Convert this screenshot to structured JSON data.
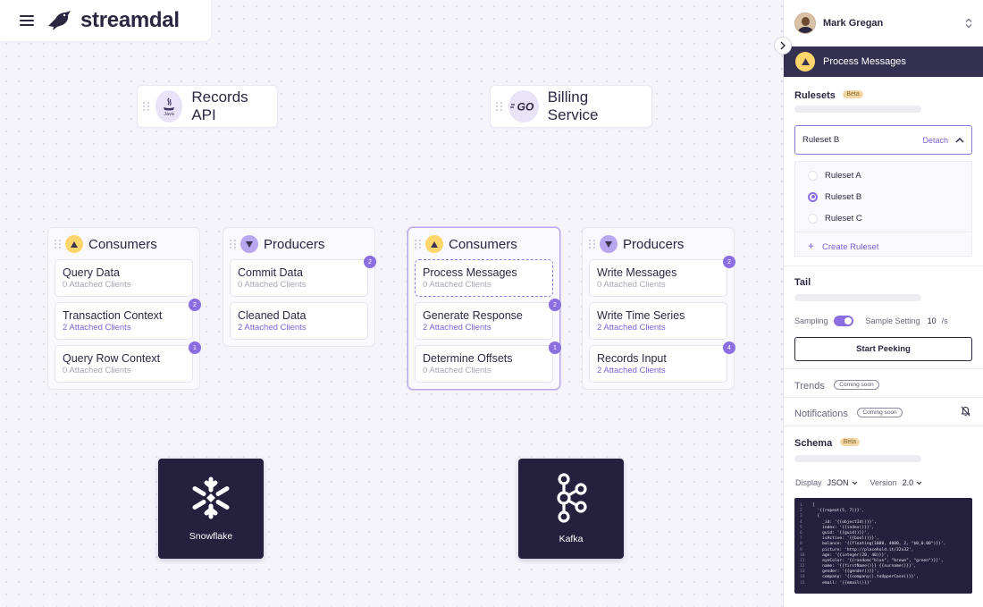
{
  "brand": {
    "name": "streamdal"
  },
  "services": [
    {
      "name": "Records API",
      "icon": "java-icon",
      "icon_text": "Java"
    },
    {
      "name": "Billing Service",
      "icon": "go-icon",
      "icon_text": "GO"
    }
  ],
  "groups": [
    {
      "title": "Consumers",
      "kind": "consumer",
      "items": [
        {
          "name": "Query Data",
          "clients": "0 Attached Clients",
          "badge": ""
        },
        {
          "name": "Transaction Context",
          "clients": "2 Attached Clients",
          "badge": "2"
        },
        {
          "name": "Query Row Context",
          "clients": "0 Attached Clients",
          "badge": "1"
        }
      ]
    },
    {
      "title": "Producers",
      "kind": "producer",
      "items": [
        {
          "name": "Commit Data",
          "clients": "0 Attached Clients",
          "badge": "2"
        },
        {
          "name": "Cleaned Data",
          "clients": "2 Attached Clients",
          "badge": ""
        }
      ]
    },
    {
      "title": "Consumers",
      "kind": "consumer",
      "items": [
        {
          "name": "Process Messages",
          "clients": "0 Attached Clients",
          "badge": ""
        },
        {
          "name": "Generate Response",
          "clients": "2 Attached Clients",
          "badge": "2"
        },
        {
          "name": "Determine Offsets",
          "clients": "0 Attached Clients",
          "badge": "1"
        }
      ]
    },
    {
      "title": "Producers",
      "kind": "producer",
      "items": [
        {
          "name": "Write Messages",
          "clients": "0 Attached Clients",
          "badge": "2"
        },
        {
          "name": "Write Time Series",
          "clients": "2 Attached Clients",
          "badge": ""
        },
        {
          "name": "Records Input",
          "clients": "2 Attached Clients",
          "badge": "4"
        }
      ]
    }
  ],
  "stores": [
    {
      "name": "Snowflake",
      "icon": "snowflake-icon"
    },
    {
      "name": "Kafka",
      "icon": "kafka-icon"
    }
  ],
  "panel": {
    "user": {
      "name": "Mark Gregan"
    },
    "header": {
      "title": "Process Messages"
    },
    "rulesets": {
      "title": "Rulesets",
      "beta": "Beta",
      "selected": "Ruleset B",
      "detach": "Detach",
      "options": [
        "Ruleset A",
        "Ruleset B",
        "Ruleset C"
      ],
      "create": "Create Ruleset"
    },
    "tail": {
      "title": "Tail",
      "sampling_label": "Sampling",
      "sampling_on": true,
      "sample_setting_label": "Sample Setting",
      "sample_value": "10",
      "sample_unit": "/s",
      "button": "Start Peeking"
    },
    "trends": {
      "title": "Trends",
      "badge": "Coming soon"
    },
    "notifications": {
      "title": "Notifications",
      "badge": "Coming soon"
    },
    "schema": {
      "title": "Schema",
      "beta": "Beta",
      "display_label": "Display",
      "display_value": "JSON",
      "version_label": "Version",
      "version_value": "2.0",
      "code_lines": [
        "[",
        "  '{{repeat(5, 7)}}',",
        "  {",
        "    _id: '{{objectId()}}',",
        "    index: '{{index()}}',",
        "    guid: '{{guid()}}',",
        "    isActive: '{{bool()}}',",
        "    balance: '{{floating(1000, 4000, 2, \"$0,0.00\")}}',",
        "    picture: 'http://placehold.it/32x32',",
        "    age: '{{integer(20, 40)}}',",
        "    eyeColor: '{{random(\"blue\", \"brown\", \"green\")}}',",
        "    name: '{{firstName()}} {{surname()}}',",
        "    gender: '{{gender()}}',",
        "    company: '{{company().toUpperCase()}}',",
        "    email: '{{email()}}'"
      ]
    }
  }
}
